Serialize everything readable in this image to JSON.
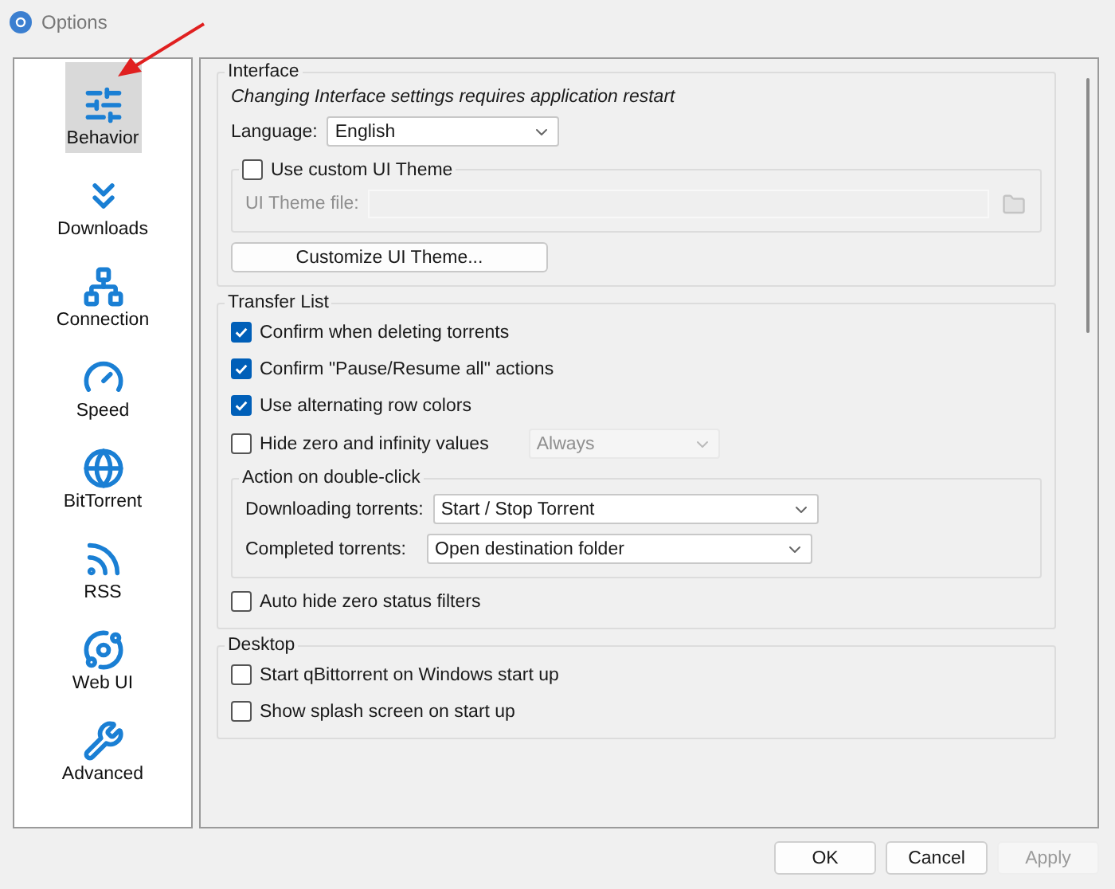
{
  "window": {
    "title": "Options"
  },
  "sidebar": {
    "items": [
      {
        "label": "Behavior",
        "kind": "sliders",
        "selected": true
      },
      {
        "label": "Downloads",
        "kind": "chevrons",
        "selected": false
      },
      {
        "label": "Connection",
        "kind": "network",
        "selected": false
      },
      {
        "label": "Speed",
        "kind": "gauge",
        "selected": false
      },
      {
        "label": "BitTorrent",
        "kind": "globe",
        "selected": false
      },
      {
        "label": "RSS",
        "kind": "rss",
        "selected": false
      },
      {
        "label": "Web UI",
        "kind": "planet",
        "selected": false
      },
      {
        "label": "Advanced",
        "kind": "tools",
        "selected": false
      }
    ]
  },
  "sections": [
    {
      "title": "Interface",
      "items": [
        {
          "kind": "note",
          "text": "Changing Interface settings requires application restart"
        },
        {
          "kind": "select",
          "label": "Language:",
          "value": "English",
          "disabled": false
        },
        {
          "kind": "group",
          "checkbox": {
            "label": "Use custom UI Theme",
            "checked": false
          },
          "items": [
            {
              "kind": "file",
              "label": "UI Theme file:",
              "disabled": true
            }
          ]
        },
        {
          "kind": "button",
          "label": "Customize UI Theme..."
        }
      ]
    },
    {
      "title": "Transfer List",
      "items": [
        {
          "kind": "checkbox",
          "label": "Confirm when deleting torrents",
          "checked": true
        },
        {
          "kind": "checkbox",
          "label": "Confirm \"Pause/Resume all\" actions",
          "checked": true
        },
        {
          "kind": "checkbox",
          "label": "Use alternating row colors",
          "checked": true
        },
        {
          "kind": "checkbox",
          "label": "Hide zero and infinity values",
          "checked": false,
          "select": {
            "value": "Always",
            "disabled": true
          }
        },
        {
          "kind": "group",
          "title": "Action on double-click",
          "items": [
            {
              "kind": "select",
              "label": "Downloading torrents:",
              "value": "Start / Stop Torrent",
              "disabled": false
            },
            {
              "kind": "select",
              "label": "Completed torrents:",
              "value": "Open destination folder",
              "disabled": false
            }
          ]
        },
        {
          "kind": "checkbox",
          "label": "Auto hide zero status filters",
          "checked": false
        }
      ]
    },
    {
      "title": "Desktop",
      "items": [
        {
          "kind": "checkbox",
          "label": "Start qBittorrent on Windows start up",
          "checked": false
        },
        {
          "kind": "checkbox",
          "label": "Show splash screen on start up",
          "checked": false
        }
      ]
    }
  ],
  "buttons": [
    {
      "label": "OK",
      "disabled": false
    },
    {
      "label": "Cancel",
      "disabled": false
    },
    {
      "label": "Apply",
      "disabled": true
    }
  ]
}
